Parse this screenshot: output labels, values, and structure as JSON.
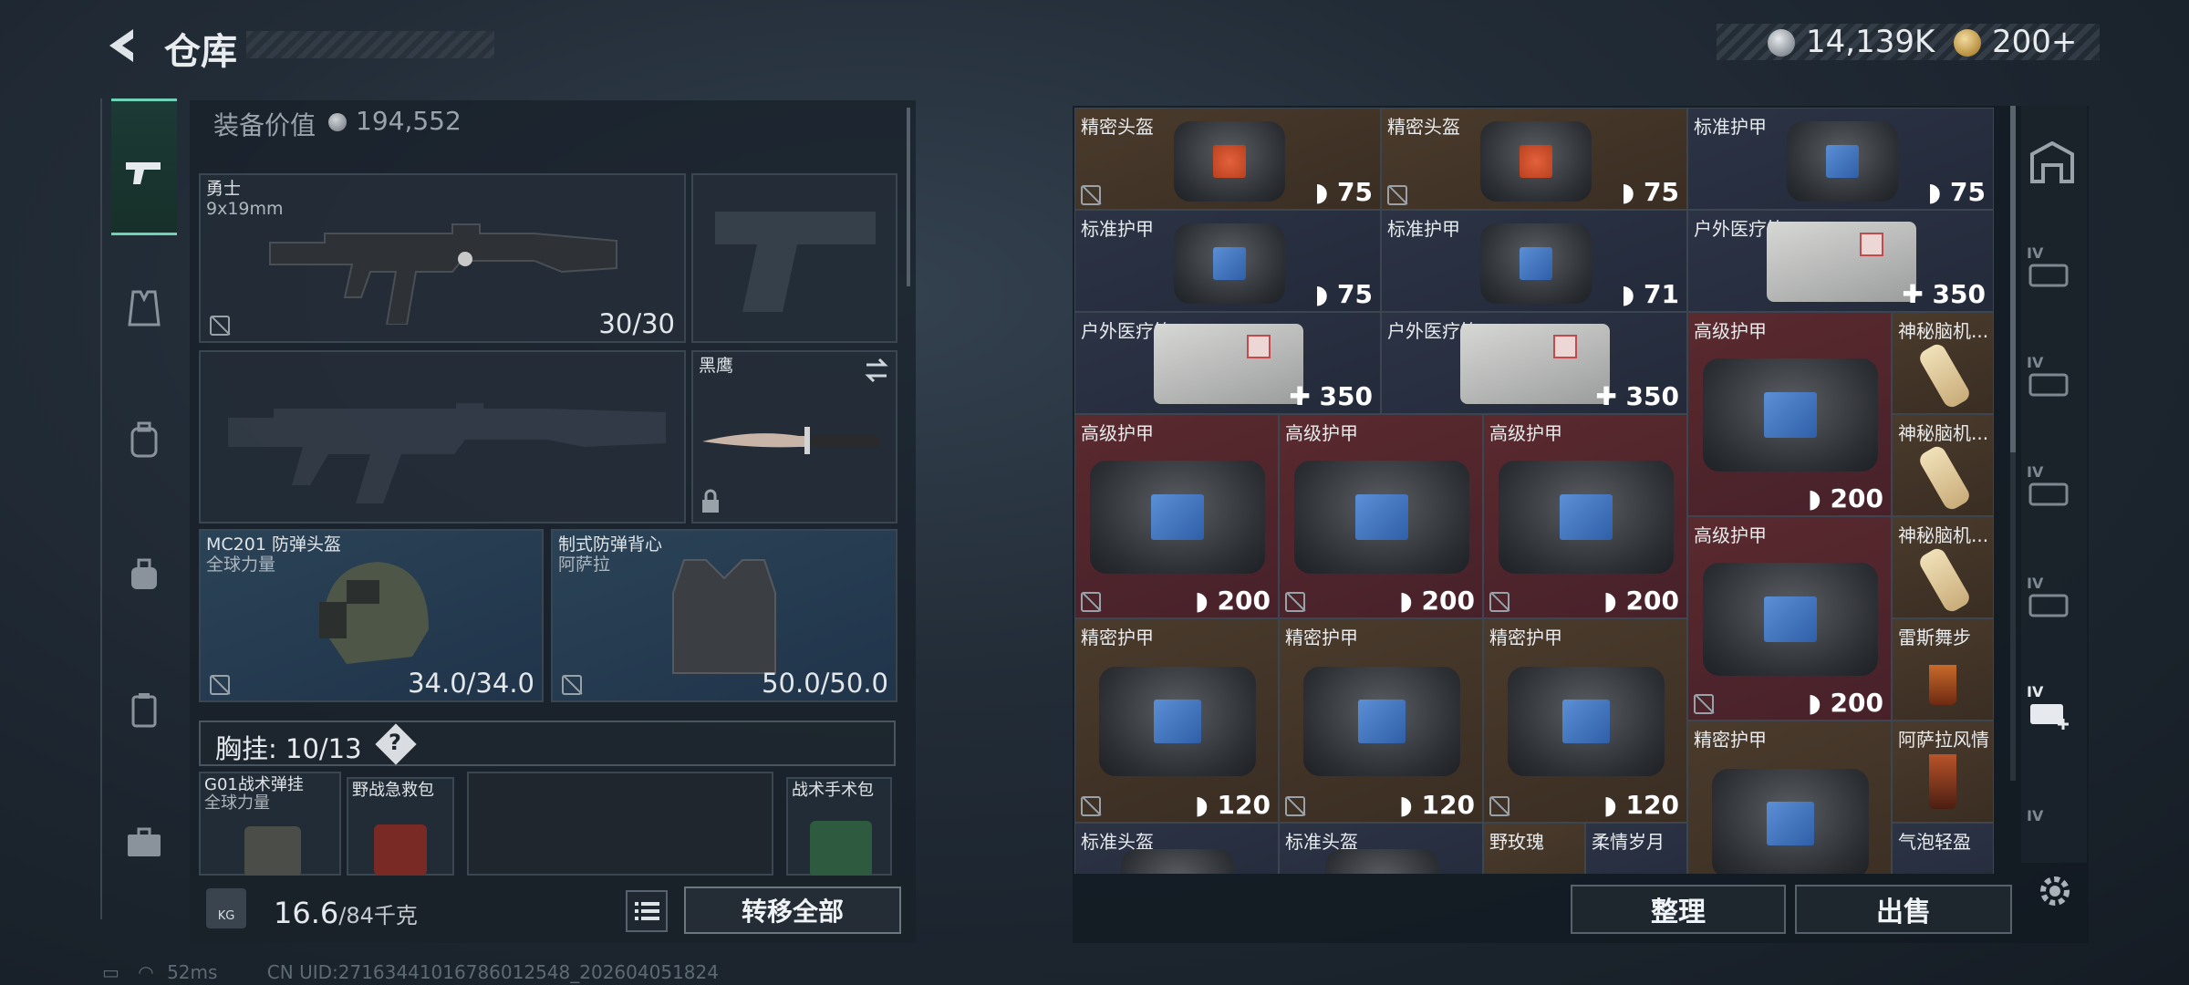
{
  "header": {
    "title": "仓库",
    "silver": "14,139K",
    "gold": "200+"
  },
  "equipment": {
    "label": "装备价值",
    "value": "194,552"
  },
  "slots": {
    "primary": {
      "name": "勇士",
      "sub": "9x19mm",
      "value": "30/30"
    },
    "melee": {
      "name": "黑鹰"
    },
    "helmet": {
      "name": "MC201 防弹头盔",
      "sub": "全球力量",
      "value": "34.0/34.0"
    },
    "vest": {
      "name": "制式防弹背心",
      "sub": "阿萨拉",
      "value": "50.0/50.0"
    }
  },
  "chest": {
    "label": "胸挂: 10/13",
    "q": "?"
  },
  "chest_items": [
    "G01战术弹挂",
    "全球力量",
    "野战急救包",
    "战术手术包"
  ],
  "bottom": {
    "weight_main": "16.6",
    "weight_unit": "/84千克",
    "kg": "KG",
    "transfer": "转移全部"
  },
  "stash_items": [
    {
      "name": "精密头盔",
      "value": "75"
    },
    {
      "name": "精密头盔",
      "value": "75"
    },
    {
      "name": "标准护甲",
      "value": "75"
    },
    {
      "name": "标准护甲",
      "value": "75"
    },
    {
      "name": "标准护甲",
      "value": "71"
    },
    {
      "name": "户外医疗箱",
      "value": "350"
    },
    {
      "name": "户外医疗箱",
      "value": "350"
    },
    {
      "name": "户外医疗箱",
      "value": "350"
    },
    {
      "name": "高级护甲",
      "value": "200"
    },
    {
      "name": "神秘脑机...",
      "value": ""
    },
    {
      "name": "神秘脑机...",
      "value": ""
    },
    {
      "name": "高级护甲",
      "value": "200"
    },
    {
      "name": "高级护甲",
      "value": "200"
    },
    {
      "name": "高级护甲",
      "value": "200"
    },
    {
      "name": "高级护甲",
      "value": "200"
    },
    {
      "name": "神秘脑机...",
      "value": ""
    },
    {
      "name": "精密护甲",
      "value": "120"
    },
    {
      "name": "精密护甲",
      "value": "120"
    },
    {
      "name": "精密护甲",
      "value": "120"
    },
    {
      "name": "雷斯舞步",
      "value": ""
    },
    {
      "name": "精密护甲",
      "value": ""
    },
    {
      "name": "阿萨拉风情",
      "value": ""
    },
    {
      "name": "标准头盔",
      "value": ""
    },
    {
      "name": "标准头盔",
      "value": ""
    },
    {
      "name": "野玫瑰",
      "value": ""
    },
    {
      "name": "柔情岁月",
      "value": ""
    },
    {
      "name": "气泡轻盈",
      "value": ""
    }
  ],
  "actions": {
    "sort": "整理",
    "sell": "出售"
  },
  "rnav_labels": [
    "IV",
    "IV",
    "IV",
    "IV",
    "IV",
    "IV"
  ],
  "status": {
    "ping": "52ms",
    "uid": "CN UID:27163441016786012548_202604051824"
  },
  "colors": {
    "accent": "#6fd1b6",
    "brown": "#4a3b2c",
    "navy": "#2c3345",
    "red": "#5a2a2e"
  }
}
